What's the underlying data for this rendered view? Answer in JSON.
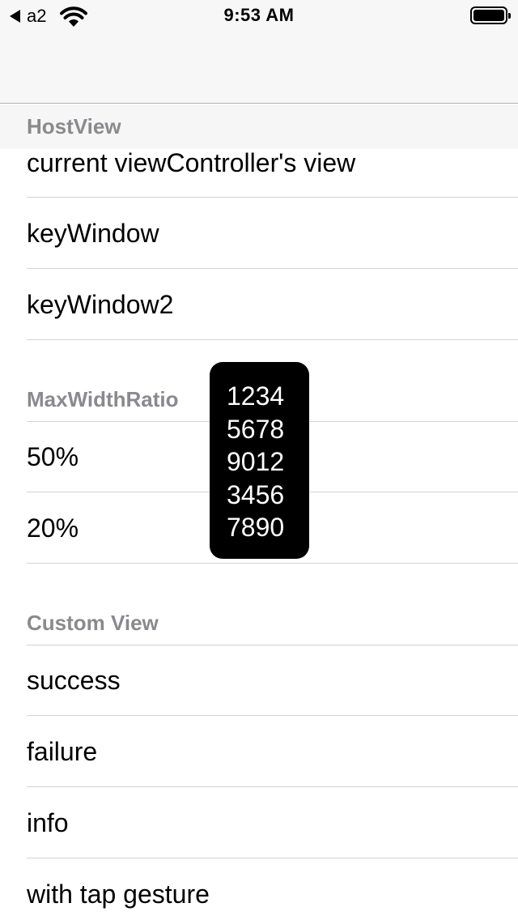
{
  "status_bar": {
    "back_label": "a2",
    "time": "9:53 AM",
    "battery_level": 1.0
  },
  "sections": [
    {
      "header": "HostView",
      "rows": [
        "current viewController's view",
        "keyWindow",
        "keyWindow2"
      ]
    },
    {
      "header": "MaxWidthRatio",
      "rows": [
        "50%",
        "20%"
      ]
    },
    {
      "header": "Custom View",
      "rows": [
        "success",
        "failure",
        "info",
        "with tap gesture"
      ]
    }
  ],
  "toast": {
    "lines": [
      "1234",
      "5678",
      "9012",
      "3456",
      "7890"
    ]
  },
  "icons": {
    "back": "back-triangle-icon",
    "wifi": "wifi-icon",
    "battery": "battery-icon"
  }
}
